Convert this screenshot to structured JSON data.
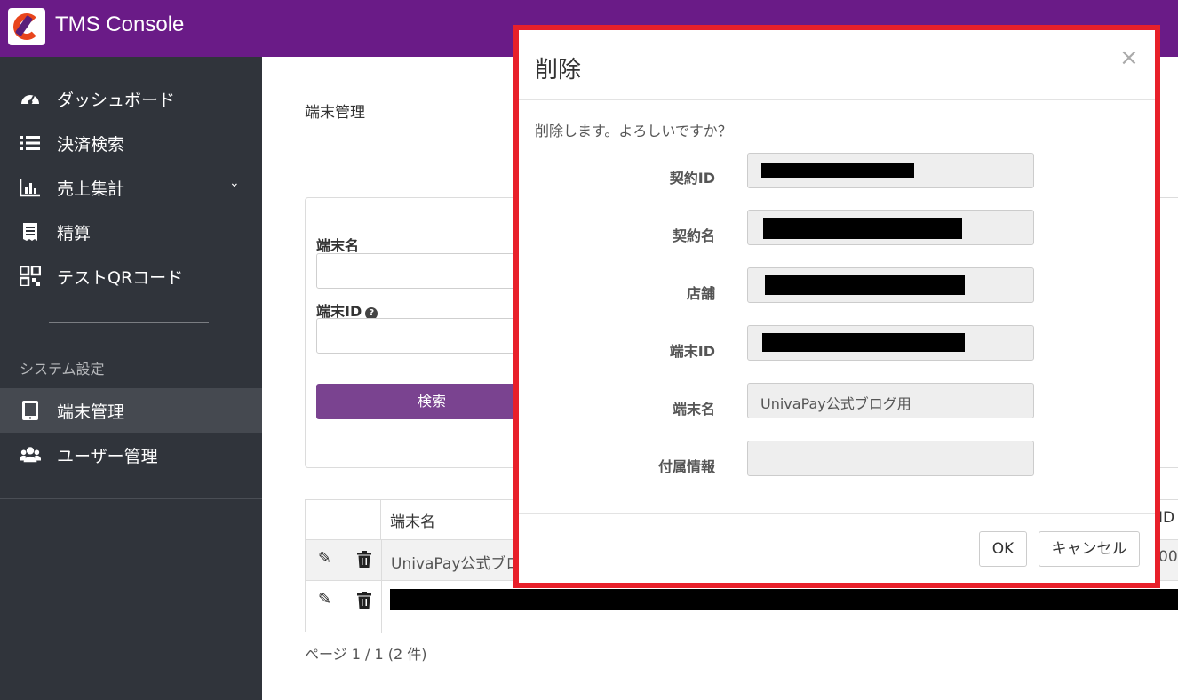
{
  "app": {
    "title": "TMS Console"
  },
  "sidebar": {
    "items": [
      {
        "label": "ダッシュボード",
        "icon": "dashboard-icon"
      },
      {
        "label": "決済検索",
        "icon": "list-icon"
      },
      {
        "label": "売上集計",
        "icon": "bar-chart-icon"
      },
      {
        "label": "精算",
        "icon": "receipt-icon"
      },
      {
        "label": "テストQRコード",
        "icon": "qr-code-icon"
      }
    ],
    "section_title": "システム設定",
    "settings_items": [
      {
        "label": "端末管理",
        "icon": "tablet-icon",
        "active": true
      },
      {
        "label": "ユーザー管理",
        "icon": "users-icon"
      }
    ]
  },
  "main": {
    "title": "端末管理",
    "search": {
      "terminal_name_label": "端末名",
      "terminal_id_label": "端末ID",
      "search_button": "検索"
    },
    "table": {
      "headers": [
        "端末名"
      ],
      "id_header_partial": "ID",
      "rows": [
        {
          "name": "UnivaPay公式ブロ",
          "trailing": "00"
        }
      ]
    },
    "pager": "ページ 1 / 1 (2 件)"
  },
  "modal": {
    "title": "削除",
    "close": "×",
    "message": "削除します。よろしいですか？",
    "fields": [
      {
        "label": "契約ID",
        "value": ""
      },
      {
        "label": "契約名",
        "value": ""
      },
      {
        "label": "店舗",
        "value": ""
      },
      {
        "label": "端末ID",
        "value": ""
      },
      {
        "label": "端末名",
        "value": "UnivaPay公式ブログ用"
      },
      {
        "label": "付属情報",
        "value": ""
      }
    ],
    "ok_button": "OK",
    "cancel_button": "キャンセル"
  },
  "colors": {
    "header": "#6a1b87",
    "sidebar": "#30343b",
    "primary_button": "#7a4390",
    "highlight_frame": "#e8202a"
  }
}
